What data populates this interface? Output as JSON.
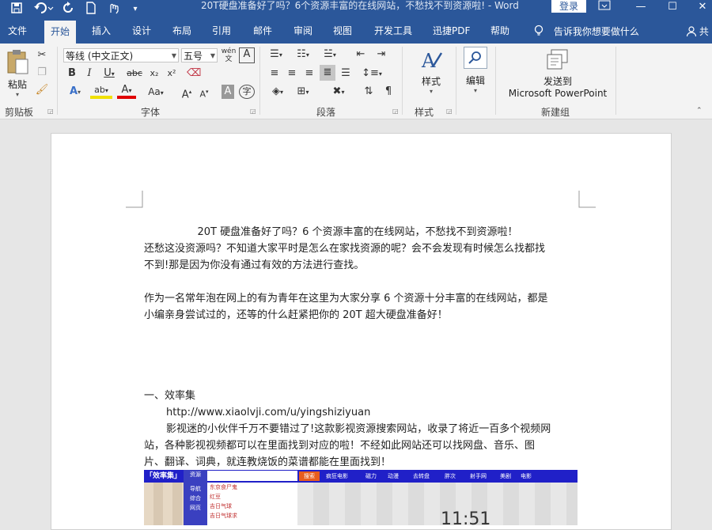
{
  "window": {
    "title": "20T硬盘准备好了吗？6个资源丰富的在线网站，不愁找不到资源啦!  -  Word",
    "login_label": "登录"
  },
  "quick_access": [
    "save-icon",
    "undo-icon",
    "redo-icon",
    "new-doc-icon",
    "touch-mode-icon",
    "customize-icon"
  ],
  "tabs": [
    {
      "label": "文件"
    },
    {
      "label": "开始"
    },
    {
      "label": "插入"
    },
    {
      "label": "设计"
    },
    {
      "label": "布局"
    },
    {
      "label": "引用"
    },
    {
      "label": "邮件"
    },
    {
      "label": "审阅"
    },
    {
      "label": "视图"
    },
    {
      "label": "开发工具"
    },
    {
      "label": "迅捷PDF"
    },
    {
      "label": "帮助"
    }
  ],
  "active_tab": "开始",
  "tell_me": "告诉我你想要做什么",
  "share_label": "共",
  "ribbon": {
    "clipboard": {
      "paste_label": "粘贴",
      "group_label": "剪贴板"
    },
    "font": {
      "font_name": "等线 (中文正文)",
      "font_size": "五号",
      "group_label": "字体"
    },
    "paragraph": {
      "group_label": "段落"
    },
    "styles": {
      "styles_label": "样式",
      "group_label": "样式"
    },
    "editing": {
      "edit_label": "编辑"
    },
    "newgroup": {
      "send_label": "发送到",
      "app_label": "Microsoft PowerPoint",
      "group_label": "新建组"
    }
  },
  "document": {
    "title_line": "20T 硬盘准备好了吗？6 个资源丰富的在线网站，不愁找不到资源啦！",
    "para1_line1": "还愁这没资源吗？不知道大家平时是怎么在家找资源的呢？会不会发现有时候怎么找都找",
    "para1_line2": "不到!那是因为你没有通过有效的方法进行查找。",
    "para2_line1": "作为一名常年泡在网上的有为青年在这里为大家分享  6  个资源十分丰富的在线网站，都是",
    "para2_line2": "小编亲身尝试过的，还等的什么赶紧把你的 20T 超大硬盘准备好！",
    "section1_heading": "一、效率集",
    "section1_url": "http://www.xiaolvji.com/u/yingshiziyuan",
    "section1_line1": "影视迷的小伙伴千万不要错过了!这款影视资源搜索网站，收录了将近一百多个视频网",
    "section1_line2": "站，各种影视视频都可以在里面找到对应的啦！不经如此网站还可以找网盘、音乐、图",
    "section1_line3": "片、翻译、词典，就连教烧饭的菜谱都能在里面找到！"
  },
  "embedded_image": {
    "logo": "「效率集」",
    "nav": [
      "资源",
      "导航",
      "综合",
      "网页"
    ],
    "search_button": "搜索",
    "dropdown": [
      "东京食尸鬼",
      "红豆",
      "吉日气球",
      "吉日气球求"
    ],
    "menu": [
      "疯狂电影",
      "磁力",
      "动漫",
      "去转盘",
      "胖次",
      "射手网",
      "美剧",
      "电影"
    ],
    "clock": "11:51"
  }
}
